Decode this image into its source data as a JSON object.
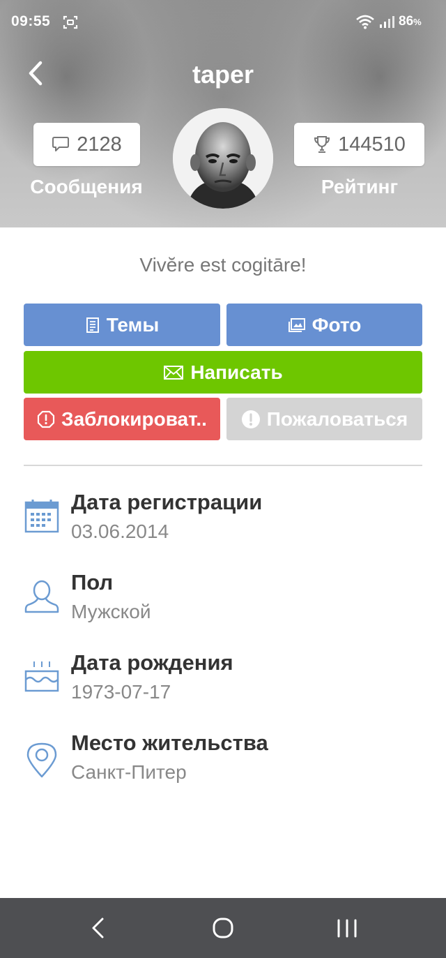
{
  "status_bar": {
    "time": "09:55",
    "battery": "86",
    "battery_unit": "%"
  },
  "header": {
    "title": "taper",
    "messages_count": "2128",
    "messages_label": "Сообщения",
    "rating_value": "144510",
    "rating_label": "Рейтинг"
  },
  "motto": "Vivĕre est cogitāre!",
  "actions": {
    "topics": "Темы",
    "photo": "Фото",
    "write": "Написать",
    "block": "Заблокироват..",
    "report": "Пожаловаться"
  },
  "info": [
    {
      "label": "Дата регистрации",
      "value": "03.06.2014",
      "icon": "calendar-icon"
    },
    {
      "label": "Пол",
      "value": "Мужской",
      "icon": "person-icon"
    },
    {
      "label": "Дата рождения",
      "value": "1973-07-17",
      "icon": "birthday-cake-icon"
    },
    {
      "label": "Место жительства",
      "value": "Санкт-Питер",
      "icon": "location-pin-icon"
    }
  ],
  "colors": {
    "primary_button": "#6790d2",
    "write_button": "#6ec600",
    "block_button": "#e85959",
    "report_button": "#d4d4d4",
    "info_icon": "#6b9bd2",
    "nav_bar": "#4e4f52"
  }
}
